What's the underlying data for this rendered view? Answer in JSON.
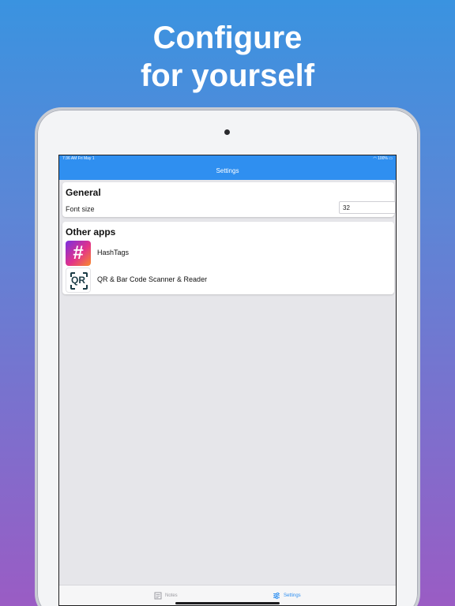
{
  "headline": {
    "line1": "Configure",
    "line2": "for yourself"
  },
  "statusbar": {
    "time": "7:36 AM   Fri May 1",
    "battery": "100%"
  },
  "navbar": {
    "title": "Settings"
  },
  "general": {
    "title": "General",
    "font_size_label": "Font size",
    "font_size_value": "32"
  },
  "other_apps": {
    "title": "Other apps",
    "apps": [
      {
        "name": "HashTags",
        "icon": "hashtag-icon",
        "glyph": "#"
      },
      {
        "name": "QR & Bar Code Scanner & Reader",
        "icon": "qr-icon",
        "glyph": "QR"
      }
    ]
  },
  "tabs": [
    {
      "label": "Notes",
      "icon": "notes-icon",
      "active": false
    },
    {
      "label": "Settings",
      "icon": "sliders-icon",
      "active": true
    }
  ],
  "colors": {
    "accent": "#2f8ff0",
    "background_top": "#3a93e0",
    "background_bottom": "#9a5cc4"
  }
}
